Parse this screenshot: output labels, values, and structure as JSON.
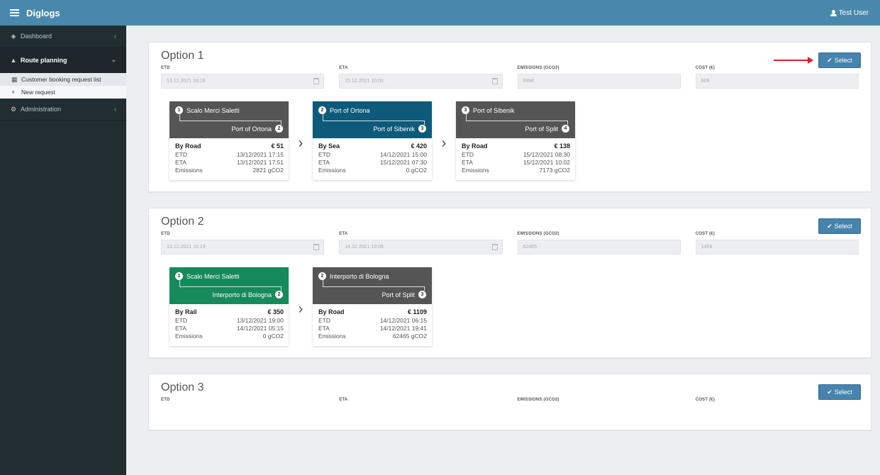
{
  "app": {
    "title": "Diglogs",
    "user": "Test User"
  },
  "sidebar": {
    "items": [
      {
        "label": "Dashboard",
        "icon": "dashboard-icon"
      },
      {
        "label": "Route planning",
        "icon": "route-icon"
      },
      {
        "label": "Administration",
        "icon": "gear-icon"
      }
    ],
    "sub_items": [
      {
        "label": "Customer booking request list",
        "icon": "list-icon"
      },
      {
        "label": "New request",
        "icon": "plus-icon"
      }
    ]
  },
  "labels": {
    "etd": "ETD",
    "eta": "ETA",
    "emissions": "EMISSIONS (GCO2)",
    "cost": "COST (€)",
    "select": "Select",
    "etd_row": "ETD",
    "eta_row": "ETA",
    "emissions_row": "Emissions"
  },
  "options": [
    {
      "title": "Option 1",
      "etd": "13.12.2021 16:19",
      "eta": "15.12.2021 10:00",
      "emissions": "9994",
      "cost": "609",
      "legs": [
        {
          "index": "1",
          "from": "Scalo Merci Saletti",
          "to": "Port of Ortona",
          "to_index": "2",
          "mode": "By Road",
          "cost": "€ 51",
          "etd": "13/12/2021 17:15",
          "eta": "13/12/2021 17:51",
          "emissions": "2821 gCO2",
          "color": "#555555"
        },
        {
          "index": "2",
          "from": "Port of Ortona",
          "to": "Port of Sibenik",
          "to_index": "3",
          "mode": "By Sea",
          "cost": "€ 420",
          "etd": "14/12/2021 15:00",
          "eta": "15/12/2021 07:30",
          "emissions": "0 gCO2",
          "color": "#0e5a7a"
        },
        {
          "index": "3",
          "from": "Port of Sibenik",
          "to": "Port of Split",
          "to_index": "4",
          "mode": "By Road",
          "cost": "€ 138",
          "etd": "15/12/2021 08:30",
          "eta": "15/12/2021 10:02",
          "emissions": "7173 gCO2",
          "color": "#555555"
        }
      ]
    },
    {
      "title": "Option 2",
      "etd": "13.12.2021 16:19",
      "eta": "14.12.2021 19:06",
      "emissions": "62465",
      "cost": "1459",
      "legs": [
        {
          "index": "1",
          "from": "Scalo Merci Saletti",
          "to": "Interporto di Bologna",
          "to_index": "2",
          "mode": "By Rail",
          "cost": "€ 350",
          "etd": "13/12/2021 19:00",
          "eta": "14/12/2021 05:15",
          "emissions": "0 gCO2",
          "color": "#168a5a"
        },
        {
          "index": "2",
          "from": "Interporto di Bologna",
          "to": "Port of Split",
          "to_index": "3",
          "mode": "By Road",
          "cost": "€ 1109",
          "etd": "14/12/2021 06:15",
          "eta": "14/12/2021 19:41",
          "emissions": "62465 gCO2",
          "color": "#555555"
        }
      ]
    },
    {
      "title": "Option 3"
    }
  ]
}
